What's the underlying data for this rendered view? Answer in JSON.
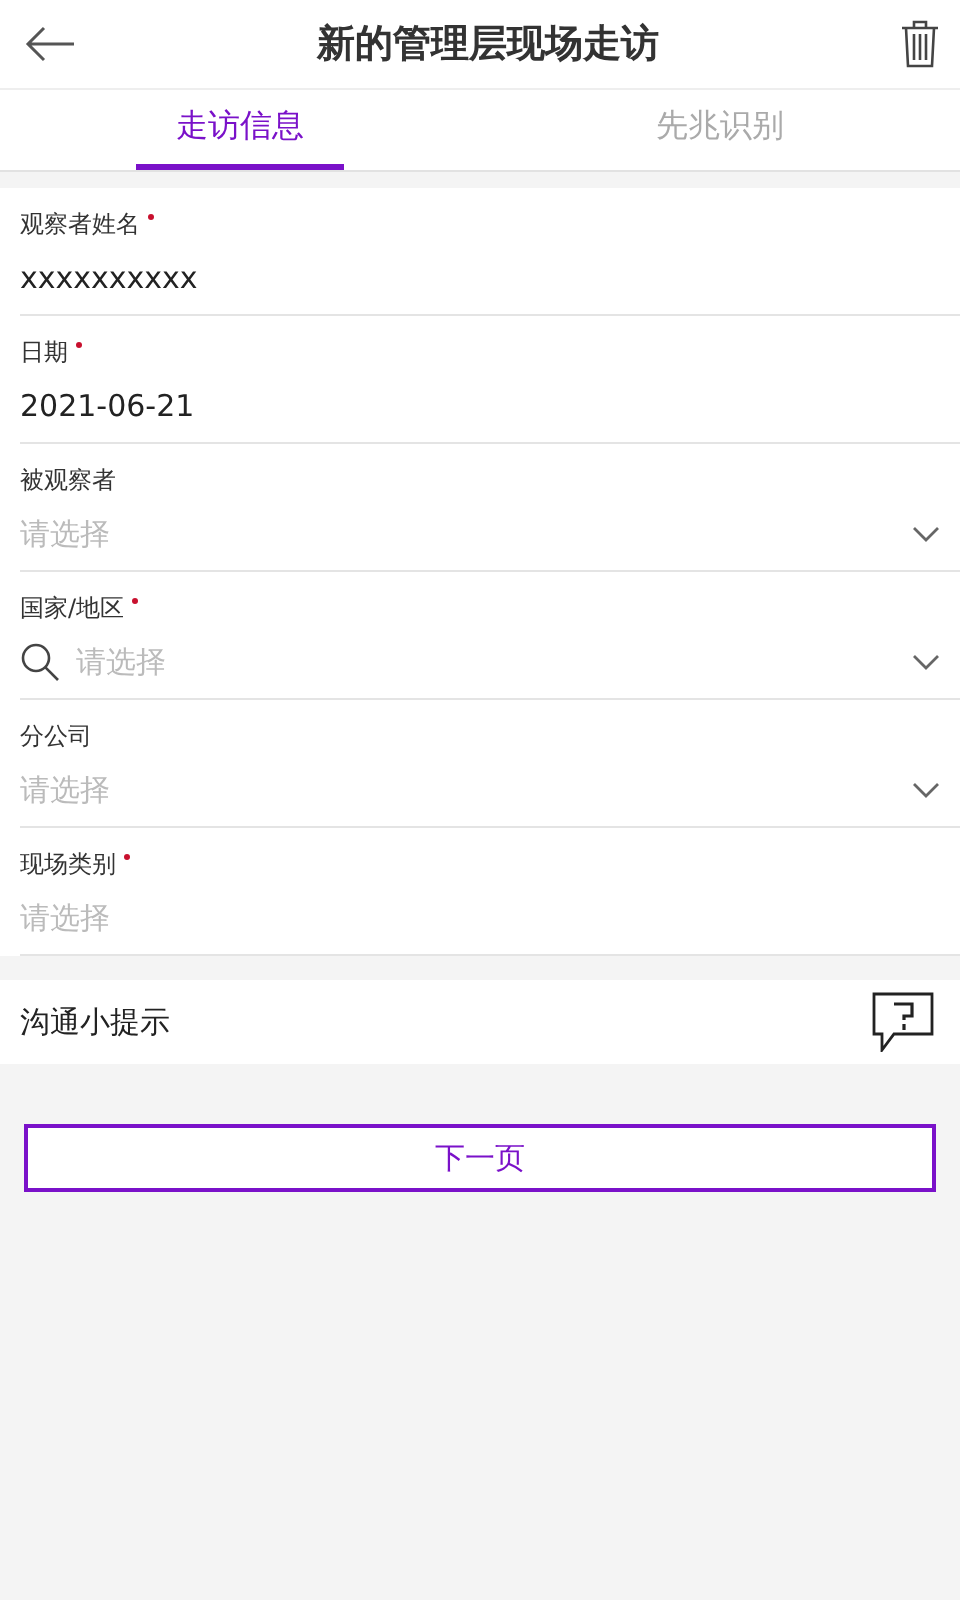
{
  "header": {
    "title": "新的管理层现场走访"
  },
  "tabs": [
    {
      "label": "走访信息",
      "selected": true
    },
    {
      "label": "先兆识别",
      "selected": false
    }
  ],
  "fields": [
    {
      "kind": "text",
      "label": "观察者姓名",
      "required": true,
      "value": "xxxxxxxxxx"
    },
    {
      "kind": "text",
      "label": "日期",
      "required": true,
      "value": "2021-06-21"
    },
    {
      "kind": "select",
      "label": "被观察者",
      "required": false,
      "placeholder": "请选择"
    },
    {
      "kind": "search",
      "label": "国家/地区",
      "required": true,
      "placeholder": "请选择"
    },
    {
      "kind": "select",
      "label": "分公司",
      "required": false,
      "placeholder": "请选择"
    },
    {
      "kind": "plain",
      "label": "现场类别",
      "required": true,
      "placeholder": "请选择"
    }
  ],
  "tips": {
    "label": "沟通小提示"
  },
  "next_button": {
    "label": "下一页"
  }
}
